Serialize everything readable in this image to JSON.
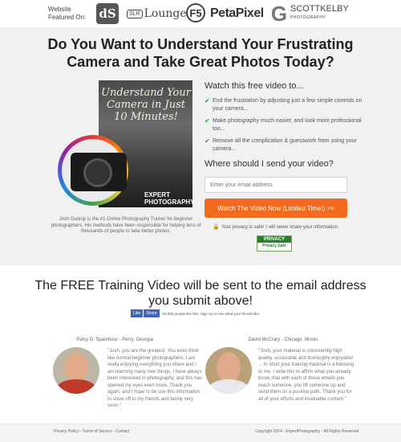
{
  "featured": {
    "label": "Website Featured On:",
    "logos": [
      {
        "name": "dps-logo",
        "text": "dS"
      },
      {
        "name": "slr-lounge-logo",
        "box": "SLR",
        "text": "Lounge"
      },
      {
        "name": "fstoppers-logo",
        "text": "F5"
      },
      {
        "name": "petapixel-logo",
        "text": "PetaPixel"
      },
      {
        "name": "gizmodo-logo",
        "text": "G"
      },
      {
        "name": "scott-kelby-logo",
        "text": "SCOTTKELBY",
        "sub": "PHOTOGRAPHY"
      }
    ]
  },
  "hero": {
    "headline": "Do You Want to Understand Your Frustrating Camera and Take Great Photos Today?",
    "product": {
      "cover_title": "Understand Your Camera in Just 10 Minutes!",
      "cover_brand": "EXPERT PHOTOGRAPHY"
    },
    "caption": "Josh Dunlop is the #1 Online Photography Trainer for beginner photographers. His methods have been responsible for helping tens of thousands of people to take better photos.",
    "watch_title": "Watch this free video to...",
    "bullets": [
      "End the frustration by adjusting just a few simple controls on your camera...",
      "Make photography much easier, and look more professional too...",
      "Remove all the complication & guesswork from using your camera..."
    ],
    "send_title": "Where should I send your video?",
    "email_placeholder": "Enter your email address",
    "cta_label": "Watch The Video Now (Limited Time!) >>",
    "privacy_text": "Your privacy is safe! I will never share your information.",
    "privacy_badge": {
      "top": "PRIVACY",
      "main": "Privacy Safe"
    }
  },
  "subhead": "The FREE Training Video will be sent to the email address you submit above!",
  "facebook": {
    "like_label": "Like",
    "share_label": "Share",
    "text_before": "92,056 people like this.",
    "link_text": "Sign Up",
    "text_after": "to see what your friends like."
  },
  "testimonials": [
    {
      "name": "Patsy D. Spainhour - Perry, Georgia",
      "quote": "\"Josh, you are the greatest. You even think like normal beginner photographers. I am really enjoying everything you share and I am learning many new things. I have always been interested in photography, and this has opened my eyes even more. Thank you again, and I hope to be use this information to show off to my friends and family very soon.\""
    },
    {
      "name": "David McCrary - Chicago, Illinois",
      "quote": "\"Josh, your material is consistently high quality, accessible and thoroughly enjoyable! ... In short your training material is a blessing to me. I write this to affirm what you already know, that with each of these emails you reach someone, you lift someone up and send them on a positive path. Thank you for all of your efforts and invaluable content.\""
    }
  ],
  "footer": {
    "privacy_policy": "Privacy Policy",
    "sep1": " - ",
    "terms": "Terms of Service",
    "sep2": " - ",
    "contact": "Contact",
    "copyright": "Copyright 2014 - ExpertPhotography - All Rights Reserved"
  },
  "colors": {
    "cta": "#f26a1b",
    "check": "#2e9e3a",
    "facebook": "#4267b2",
    "hero_bg": "#f1f1f1"
  }
}
